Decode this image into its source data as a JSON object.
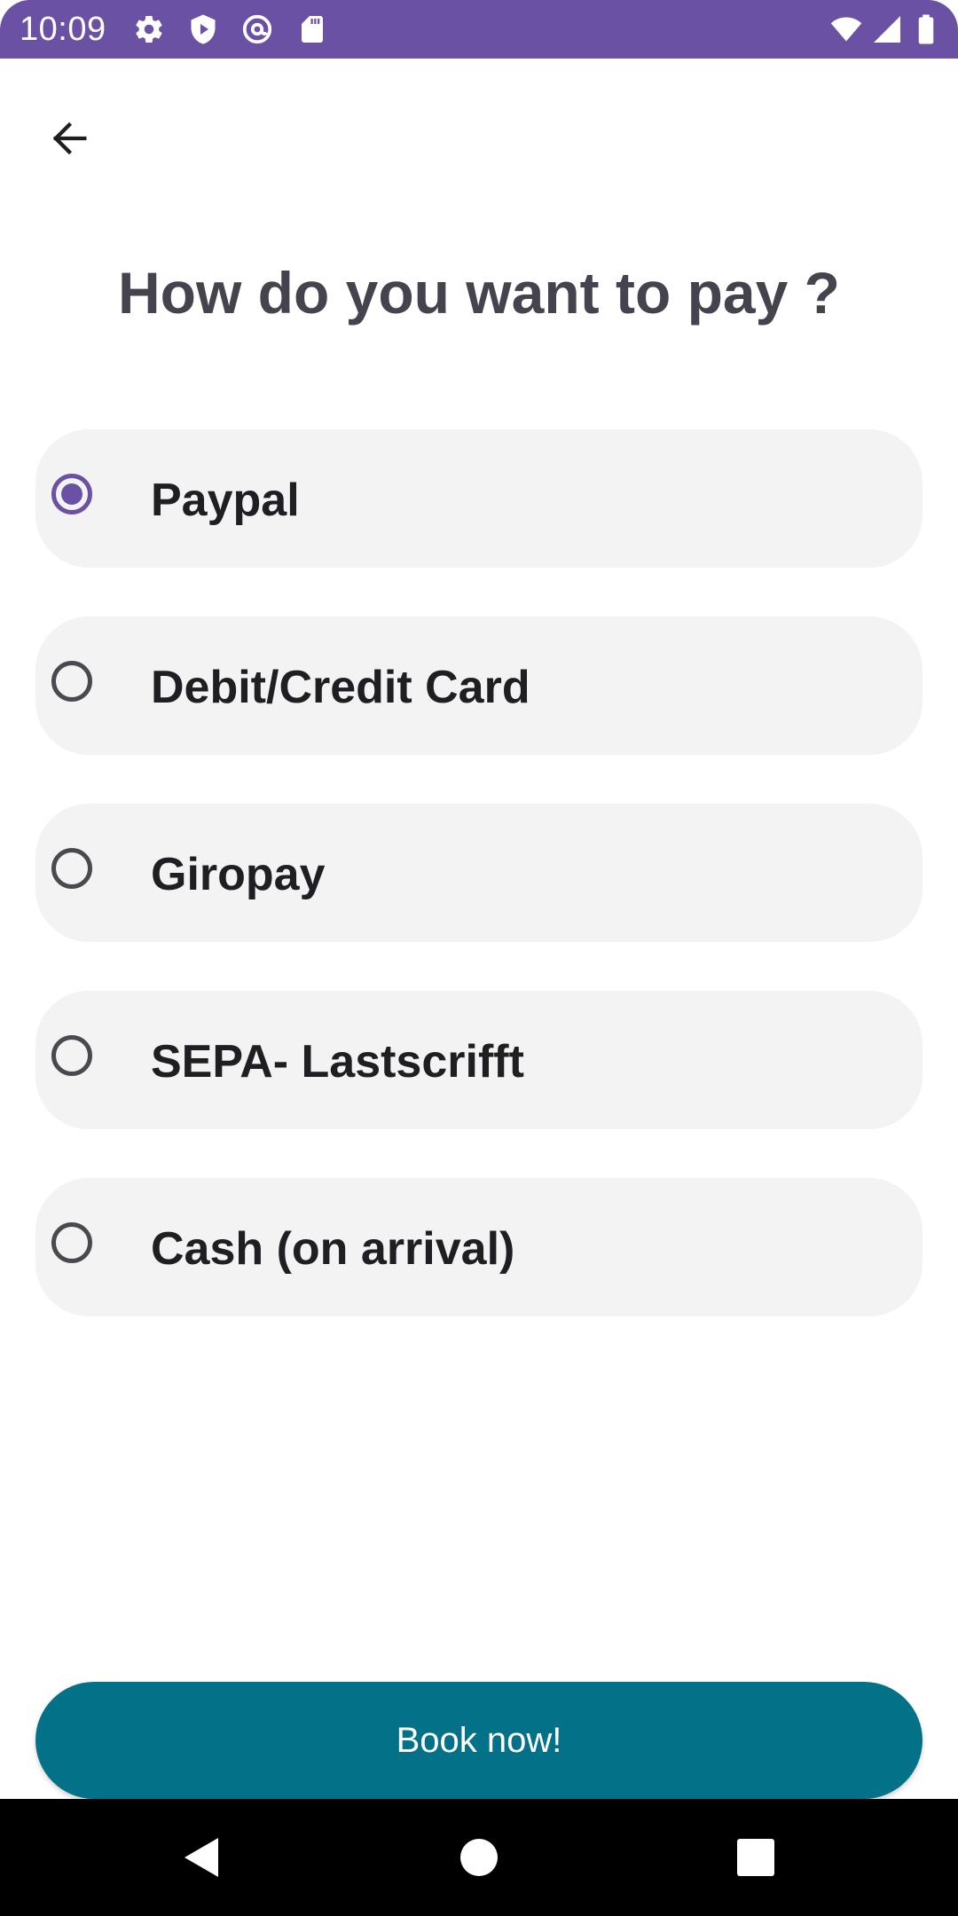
{
  "status_bar": {
    "time": "10:09",
    "background_color": "#6b51a3",
    "left_icons": [
      "gear-icon",
      "shield-icon",
      "at-sign-icon",
      "sd-card-icon"
    ],
    "right_icons": [
      "wifi-icon",
      "cell-signal-icon",
      "battery-icon"
    ]
  },
  "header": {
    "back_icon": "arrow-left-icon"
  },
  "page": {
    "title": "How do you want to pay ?"
  },
  "payment_options": [
    {
      "label": "Paypal",
      "selected": true
    },
    {
      "label": "Debit/Credit Card",
      "selected": false
    },
    {
      "label": "Giropay",
      "selected": false
    },
    {
      "label": "SEPA- Lastscrifft",
      "selected": false
    },
    {
      "label": "Cash (on arrival)",
      "selected": false
    }
  ],
  "actions": {
    "book_label": "Book now!",
    "book_color": "#037187"
  },
  "nav_bar": {
    "icons": [
      "back-triangle-icon",
      "home-circle-icon",
      "recents-square-icon"
    ]
  },
  "colors": {
    "accent": "#6b51a3",
    "option_background": "#f3f3f3",
    "title_text": "#45434d"
  }
}
